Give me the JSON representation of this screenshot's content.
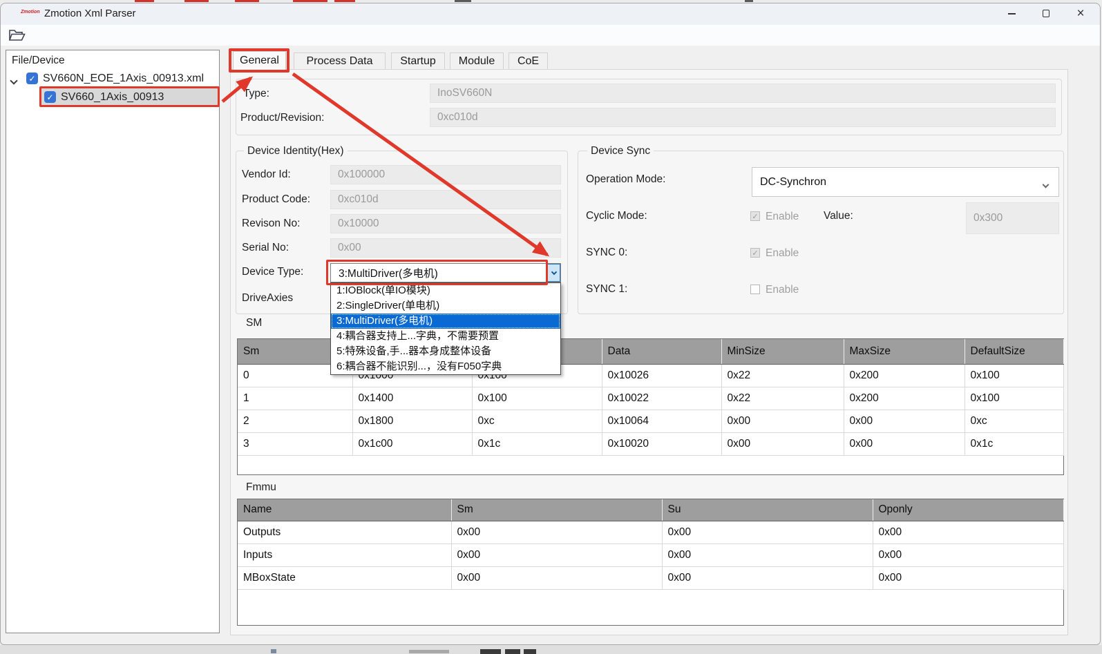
{
  "window": {
    "title": "Zmotion Xml Parser",
    "logo_text": "Zmotion"
  },
  "icons": {
    "checkmark": "✓",
    "close": "×",
    "folder_open": "folder-open-icon",
    "chevron_down": "chevron-down"
  },
  "tree": {
    "header": "File/Device",
    "root": {
      "label": "SV660N_EOE_1Axis_00913.xml",
      "checked": true
    },
    "child": {
      "label": "SV660_1Axis_00913",
      "checked": true,
      "selected": true
    }
  },
  "tabs": [
    {
      "label": "General",
      "active": true
    },
    {
      "label": "Process Data",
      "active": false
    },
    {
      "label": "Startup",
      "active": false
    },
    {
      "label": "Module",
      "active": false
    },
    {
      "label": "CoE",
      "active": false
    }
  ],
  "general": {
    "type": {
      "label": "Type:",
      "value": "InoSV660N"
    },
    "product_revision": {
      "label": "Product/Revision:",
      "value": "0xc010d"
    },
    "device_identity": {
      "title": "Device Identity(Hex)",
      "vendor_id": {
        "label": "Vendor Id:",
        "value": "0x100000"
      },
      "product_code": {
        "label": "Product Code:",
        "value": "0xc010d"
      },
      "revison_no": {
        "label": "Revison No:",
        "value": "0x10000"
      },
      "serial_no": {
        "label": "Serial No:",
        "value": "0x00"
      },
      "device_type": {
        "label": "Device Type:",
        "value": "3:MultiDriver(多电机)"
      },
      "drive_axies_label": "DriveAxies"
    },
    "device_type_dropdown": {
      "options": [
        {
          "label": "1:IOBlock(单IO模块)",
          "selected": false
        },
        {
          "label": "2:SingleDriver(单电机)",
          "selected": false
        },
        {
          "label": "3:MultiDriver(多电机)",
          "selected": true
        },
        {
          "label": "4:耦合器支持上...字典，不需要预置",
          "selected": false
        },
        {
          "label": "5:特殊设备,手...器本身成整体设备",
          "selected": false
        },
        {
          "label": "6:耦合器不能识别...，没有F050字典",
          "selected": false
        }
      ]
    },
    "device_sync": {
      "title": "Device Sync",
      "operation_mode": {
        "label": "Operation Mode:",
        "value": "DC-Synchron"
      },
      "cyclic_mode": {
        "label": "Cyclic Mode:",
        "checkbox_label": "Enable",
        "checked": true
      },
      "value_field": {
        "label": "Value:",
        "value": "0x300"
      },
      "sync0": {
        "label": "SYNC 0:",
        "checkbox_label": "Enable",
        "checked": true
      },
      "sync1": {
        "label": "SYNC 1:",
        "checkbox_label": "Enable",
        "checked": false
      }
    },
    "sm": {
      "title": "SM",
      "columns": [
        "Sm",
        "",
        "",
        "Data",
        "MinSize",
        "MaxSize",
        "DefaultSize"
      ],
      "rows": [
        [
          "0",
          "0x1000",
          "0x100",
          "0x10026",
          "0x22",
          "0x200",
          "0x100"
        ],
        [
          "1",
          "0x1400",
          "0x100",
          "0x10022",
          "0x22",
          "0x200",
          "0x100"
        ],
        [
          "2",
          "0x1800",
          "0xc",
          "0x10064",
          "0x00",
          "0x00",
          "0xc"
        ],
        [
          "3",
          "0x1c00",
          "0x1c",
          "0x10020",
          "0x00",
          "0x00",
          "0x1c"
        ]
      ]
    },
    "fmmu": {
      "title": "Fmmu",
      "columns": [
        "Name",
        "Sm",
        "Su",
        "Oponly"
      ],
      "rows": [
        [
          "Outputs",
          "0x00",
          "0x00",
          "0x00"
        ],
        [
          "Inputs",
          "0x00",
          "0x00",
          "0x00"
        ],
        [
          "MBoxState",
          "0x00",
          "0x00",
          "0x00"
        ]
      ]
    }
  },
  "annotation": {
    "color": "#e0392b",
    "note": "red boxes on General tab, tree item, Device Type combo; arrows tree-item→General tab and General tab→Device Type combo"
  },
  "colors": {
    "selection_blue": "#0a6ad4",
    "checkbox_blue": "#3574d4",
    "table_header_gray": "#9e9e9e",
    "titlebar": "#eef1f6"
  }
}
